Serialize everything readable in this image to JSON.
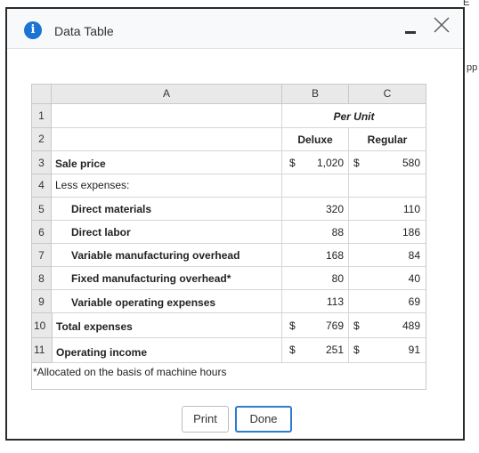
{
  "background": {
    "right_fragment_1": "E",
    "right_fragment_2": "pp"
  },
  "dialog": {
    "title": "Data Table",
    "info_icon_glyph": "i",
    "close_glyph": "×"
  },
  "sheet": {
    "columns": [
      "A",
      "B",
      "C"
    ],
    "rows": [
      {
        "num": "1",
        "a": "",
        "b": "Per Unit",
        "c": ""
      },
      {
        "num": "2",
        "a": "",
        "b": "Deluxe",
        "c": "Regular"
      },
      {
        "num": "3",
        "a": "Sale price",
        "b_sym": "$",
        "b": "1,020",
        "c_sym": "$",
        "c": "580"
      },
      {
        "num": "4",
        "a": "Less expenses:",
        "b": "",
        "c": ""
      },
      {
        "num": "5",
        "a": "Direct materials",
        "b": "320",
        "c": "110"
      },
      {
        "num": "6",
        "a": "Direct labor",
        "b": "88",
        "c": "186"
      },
      {
        "num": "7",
        "a": "Variable manufacturing overhead",
        "b": "168",
        "c": "84"
      },
      {
        "num": "8",
        "a": "Fixed manufacturing overhead*",
        "b": "80",
        "c": "40"
      },
      {
        "num": "9",
        "a": "Variable operating expenses",
        "b": "113",
        "c": "69"
      },
      {
        "num": "10",
        "a": "Total expenses",
        "b_sym": "$",
        "b": "769",
        "c_sym": "$",
        "c": "489"
      },
      {
        "num": "11",
        "a": "Operating income",
        "b_sym": "$",
        "b": "251",
        "c_sym": "$",
        "c": "91"
      }
    ]
  },
  "footnote": "*Allocated on the basis of machine hours",
  "buttons": {
    "print": "Print",
    "done": "Done"
  }
}
